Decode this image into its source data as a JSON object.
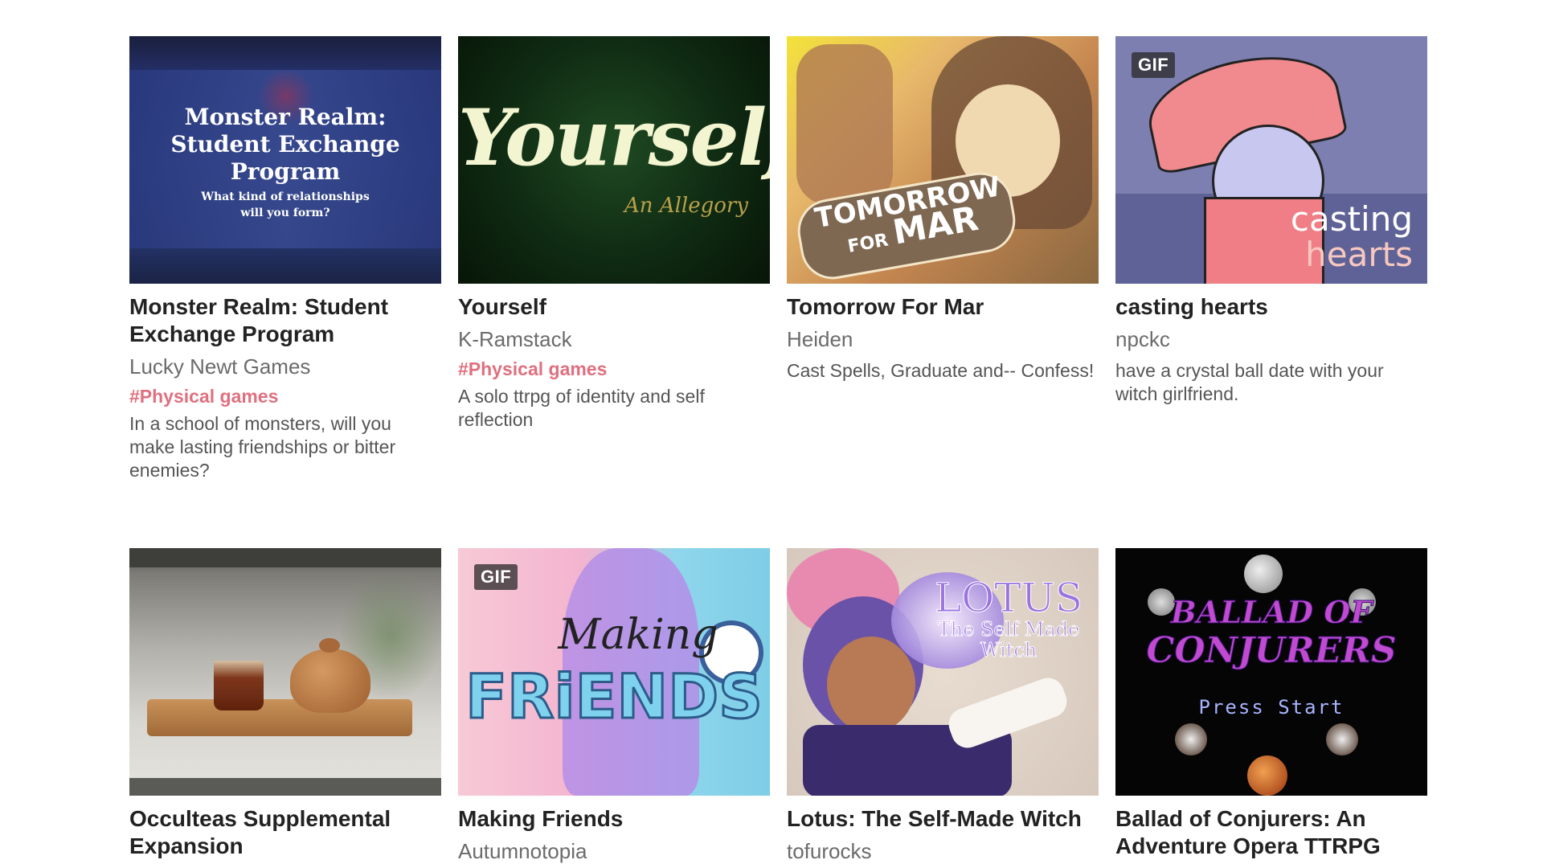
{
  "games": [
    {
      "title": "Monster Realm: Student Exchange Program",
      "author": "Lucky Newt Games",
      "tag": "#Physical games",
      "description": "In a school of monsters, will you make lasting friendships or bitter enemies?",
      "gif": false,
      "art": {
        "line1": "Monster Realm:",
        "line2": "Student Exchange",
        "line3": "Program",
        "sub1": "What kind of relationships",
        "sub2": "will you form?"
      }
    },
    {
      "title": "Yourself",
      "author": "K-Ramstack",
      "tag": "#Physical games",
      "description": "A solo ttrpg of identity and self reflection",
      "gif": false,
      "art": {
        "main": "Yourself",
        "sub": "An Allegory"
      }
    },
    {
      "title": "Tomorrow For Mar",
      "author": "Heiden",
      "tag": "",
      "description": "Cast Spells, Graduate and-- Confess!",
      "gif": false,
      "art": {
        "line1": "TOMORROW",
        "line2": "FOR",
        "line3": "MAR"
      }
    },
    {
      "title": "casting hearts",
      "author": "npckc",
      "tag": "",
      "description": "have a crystal ball date with your witch girlfriend.",
      "gif": true,
      "gif_label": "GIF",
      "art": {
        "line1": "casting",
        "line2": "hearts"
      }
    },
    {
      "title": "Occulteas Supplemental Expansion",
      "author": "",
      "tag": "",
      "description": "",
      "gif": false,
      "art": {}
    },
    {
      "title": "Making Friends",
      "author": "Autumnotopia",
      "tag": "",
      "description": "",
      "gif": true,
      "gif_label": "GIF",
      "art": {
        "line1": "Making",
        "line2": "FRiENDS"
      }
    },
    {
      "title": "Lotus: The Self-Made Witch",
      "author": "tofurocks",
      "tag": "",
      "description": "",
      "gif": false,
      "art": {
        "line1": "LOTUS",
        "line2": "The Self Made",
        "line3": "Witch"
      }
    },
    {
      "title": "Ballad of Conjurers: An Adventure Opera TTRPG",
      "author": "",
      "tag": "",
      "description": "",
      "gif": false,
      "art": {
        "line1": "BALLAD OF",
        "line2": "CONJURERS",
        "line3": "Press Start"
      }
    }
  ],
  "colors": {
    "title": "#222222",
    "author": "#6b6b6b",
    "tag": "#e0707f",
    "description": "#555555"
  }
}
